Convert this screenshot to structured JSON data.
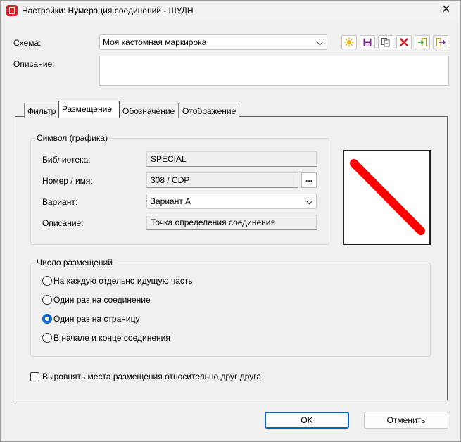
{
  "window": {
    "title": "Настройки: Нумерация соединений - ШУДН",
    "close_glyph": "✕"
  },
  "scheme": {
    "label": "Схема:",
    "value": "Моя кастомная маркирока"
  },
  "toolbar": {
    "icons": [
      "new-icon",
      "save-icon",
      "copy-icon",
      "delete-icon",
      "import-icon",
      "export-icon"
    ]
  },
  "description": {
    "label": "Описание:",
    "value": ""
  },
  "tabs": [
    {
      "label": "Фильтр"
    },
    {
      "label": "Размещение"
    },
    {
      "label": "Обозначение"
    },
    {
      "label": "Отображение"
    }
  ],
  "symbol_group": {
    "title": "Символ (графика)",
    "library_label": "Библиотека:",
    "library_value": "SPECIAL",
    "number_label": "Номер / имя:",
    "number_value": "308 / CDP",
    "browse_label": "...",
    "variant_label": "Вариант:",
    "variant_value": "Вариант A",
    "desc_label": "Описание:",
    "desc_value": "Точка определения соединения"
  },
  "placement_group": {
    "title": "Число размещений",
    "options": [
      {
        "label": "На каждую отдельно идущую часть",
        "checked": false
      },
      {
        "label": "Один раз на соединение",
        "checked": false
      },
      {
        "label": "Один раз на страницу",
        "checked": true
      },
      {
        "label": "В начале и конце соединения",
        "checked": false
      }
    ]
  },
  "align_checkbox": {
    "label": "Выровнять места размещения относительно друг друга",
    "checked": false
  },
  "buttons": {
    "ok": "OK",
    "cancel": "Отменить"
  },
  "colors": {
    "preview_line": "#ff0000",
    "accent": "#0a64c8"
  }
}
